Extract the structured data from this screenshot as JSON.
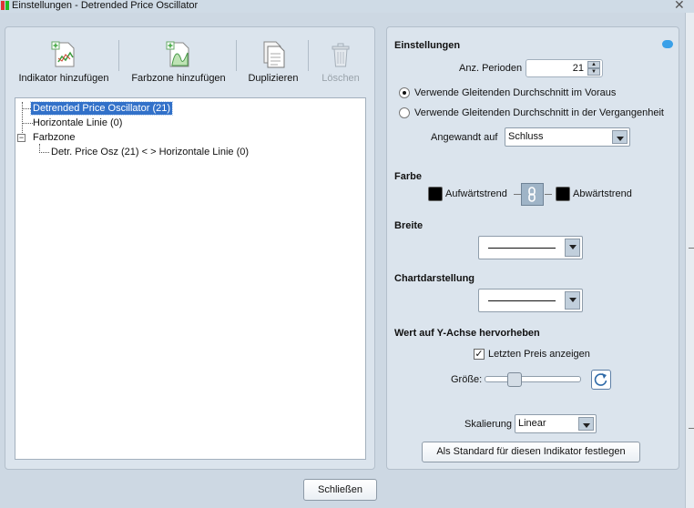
{
  "window": {
    "title": "Einstellungen - Detrended Price Oscillator"
  },
  "toolbar": {
    "add_indicator": "Indikator hinzufügen",
    "add_colorzone": "Farbzone hinzufügen",
    "duplicate": "Duplizieren",
    "delete": "Löschen"
  },
  "tree": {
    "items": [
      "Detrended Price Oscillator (21)",
      "Horizontale Linie (0)",
      "Farbzone",
      "Detr. Price Osz (21) < > Horizontale Linie (0)"
    ]
  },
  "settings": {
    "heading": "Einstellungen",
    "periods_label": "Anz. Perioden",
    "periods_value": "21",
    "radio_forward": "Verwende Gleitenden Durchschnitt im Voraus",
    "radio_past": "Verwende Gleitenden Durchschnitt in der Vergangenheit",
    "applied_label": "Angewandt auf",
    "applied_value": "Schluss"
  },
  "color": {
    "heading": "Farbe",
    "up_label": "Aufwärtstrend",
    "down_label": "Abwärtstrend",
    "up_color": "#000000",
    "down_color": "#000000"
  },
  "width": {
    "heading": "Breite"
  },
  "chart_style": {
    "heading": "Chartdarstellung"
  },
  "yaxis": {
    "heading": "Wert auf Y-Achse hervorheben",
    "show_last_price": "Letzten Preis anzeigen",
    "size_label": "Größe:"
  },
  "scaling": {
    "label": "Skalierung",
    "value": "Linear"
  },
  "buttons": {
    "set_default": "Als Standard für diesen Indikator festlegen",
    "close": "Schließen"
  }
}
